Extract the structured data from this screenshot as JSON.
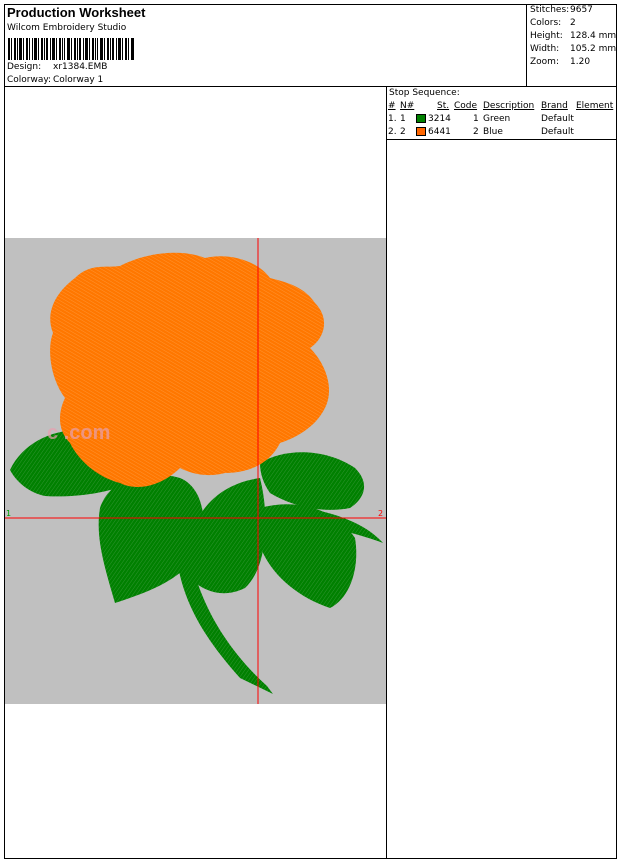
{
  "header": {
    "title": "Production Worksheet",
    "company": "Wilcom  Embroidery Studio",
    "design_label": "Design:",
    "design_value": "xr1384.EMB",
    "colorway_label": "Colorway:",
    "colorway_value": "Colorway  1"
  },
  "stats": [
    {
      "label": "Stitches:",
      "value": "9657"
    },
    {
      "label": "Colors:",
      "value": "2"
    },
    {
      "label": "Height:",
      "value": "128.4 mm"
    },
    {
      "label": "Width:",
      "value": "105.2 mm"
    },
    {
      "label": "Zoom:",
      "value": "1.20"
    }
  ],
  "stop_sequence": {
    "title": "Stop  Sequence:",
    "columns": [
      "#",
      "N#",
      "St.",
      "Code",
      "Description",
      "Brand",
      "Element"
    ],
    "rows": [
      {
        "num": "1.",
        "n": "1",
        "color": "#008000",
        "st": "3214",
        "code": "1",
        "description": "Green",
        "brand": "Default",
        "element": ""
      },
      {
        "num": "2.",
        "n": "2",
        "color": "#ff6600",
        "st": "6441",
        "code": "2",
        "description": "Blue",
        "brand": "Default",
        "element": ""
      }
    ]
  },
  "design": {
    "background": "#c0c0c0",
    "leaf_color": "#008000",
    "flower_color": "#ff7700",
    "crosshair_color": "#ff0000",
    "start_marker": "1",
    "end_marker": "2",
    "watermark": "c                     .com"
  }
}
